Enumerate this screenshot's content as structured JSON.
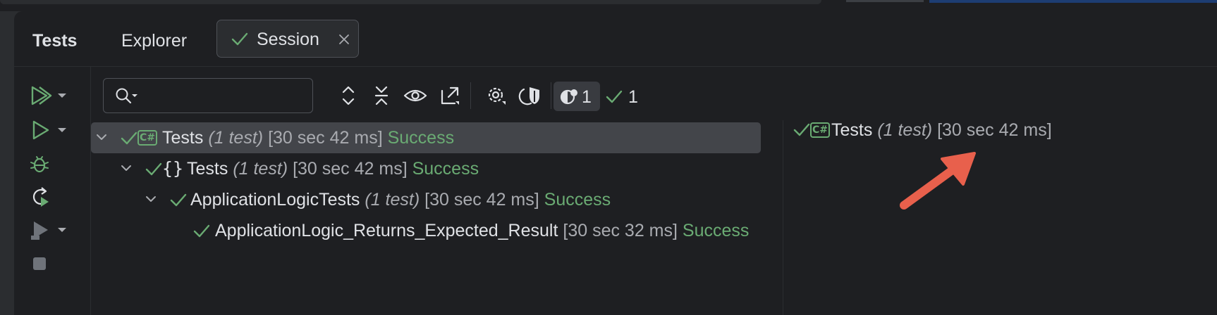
{
  "tabs": {
    "title": "Tests",
    "explorer": "Explorer",
    "session": "Session"
  },
  "search": {
    "value": "",
    "placeholder": ""
  },
  "toolbar": {
    "show_passed_count": "1",
    "passed_count": "1"
  },
  "tree": [
    {
      "name": "Tests",
      "count": "(1 test)",
      "time": "[30 sec 42 ms]",
      "status": "Success",
      "icon": "csharp-project-icon"
    },
    {
      "name": "Tests",
      "count": "(1 test)",
      "time": "[30 sec 42 ms]",
      "status": "Success",
      "icon": "namespace-icon",
      "glyph": "{}"
    },
    {
      "name": "ApplicationLogicTests",
      "count": "(1 test)",
      "time": "[30 sec 42 ms]",
      "status": "Success",
      "icon": "none"
    },
    {
      "name": "ApplicationLogic_Returns_Expected_Result",
      "time": "[30 sec 32 ms]",
      "status": "Success",
      "icon": "none"
    }
  ],
  "output": {
    "badge": "C#",
    "name": "Tests",
    "count": "(1 test)",
    "time": "[30 sec 42 ms]"
  },
  "colors": {
    "success": "#6aab73",
    "arrow": "#e8604c",
    "background": "#1e1f22",
    "selected_row": "#43454a"
  }
}
